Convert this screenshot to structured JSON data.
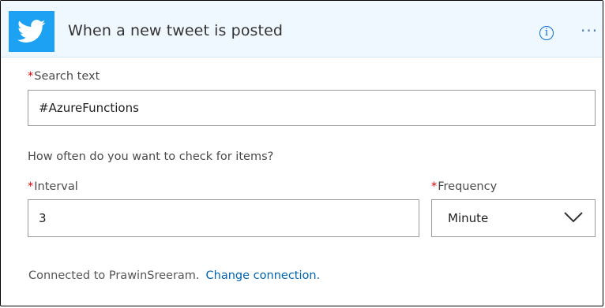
{
  "header": {
    "title": "When a new tweet is posted",
    "info_icon": "info-icon",
    "more_icon": "more-icon",
    "more_glyph": "···",
    "info_glyph": "i",
    "brand_color": "#1da1f2"
  },
  "search": {
    "required_mark": "*",
    "label": "Search text",
    "value": "#AzureFunctions"
  },
  "recurrence": {
    "question": "How often do you want to check for items?",
    "interval": {
      "required_mark": "*",
      "label": "Interval",
      "value": "3"
    },
    "frequency": {
      "required_mark": "*",
      "label": "Frequency",
      "value": "Minute"
    }
  },
  "connection": {
    "text": "Connected to PrawinSreeram.",
    "link_label": "Change connection."
  }
}
